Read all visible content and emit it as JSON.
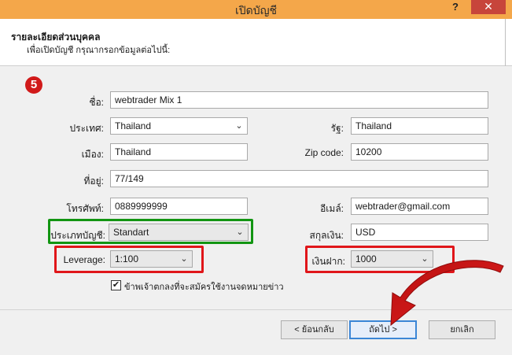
{
  "window": {
    "title": "เปิดบัญชี",
    "help": "?",
    "close": "✕"
  },
  "header": {
    "title": "รายละเอียดส่วนบุคคล",
    "subtitle": "เพื่อเปิดบัญชี กรุณากรอกข้อมูลต่อไปนี้:"
  },
  "step": "5",
  "form": {
    "name": {
      "label": "ชื่อ:",
      "value": "webtrader Mix 1"
    },
    "country": {
      "label": "ประเทศ:",
      "value": "Thailand"
    },
    "state": {
      "label": "รัฐ:",
      "value": "Thailand"
    },
    "city": {
      "label": "เมือง:",
      "value": "Thailand"
    },
    "zip": {
      "label": "Zip code:",
      "value": "10200"
    },
    "address": {
      "label": "ที่อยู่:",
      "value": "77/149"
    },
    "phone": {
      "label": "โทรศัพท์:",
      "value": "0889999999"
    },
    "email": {
      "label": "อีเมล์:",
      "value": "webtrader@gmail.com"
    },
    "account_type": {
      "label": "ประเภทบัญชี:",
      "value": "Standart"
    },
    "currency": {
      "label": "สกุลเงิน:",
      "value": "USD"
    },
    "leverage": {
      "label": "Leverage:",
      "value": "1:100"
    },
    "deposit": {
      "label": "เงินฝาก:",
      "value": "1000"
    },
    "newsletter": {
      "label": "ข้าพเจ้าตกลงที่จะสมัครใช้งานจดหมายข่าว",
      "checked": true,
      "mark": "✔"
    }
  },
  "buttons": {
    "back": "< ย้อนกลับ",
    "next": "ถัดไป >",
    "cancel": "ยกเลิก"
  },
  "colors": {
    "titlebar": "#f4a74a",
    "highlight_green": "#129512",
    "highlight_red": "#e0161a",
    "arrow": "#c11414"
  }
}
